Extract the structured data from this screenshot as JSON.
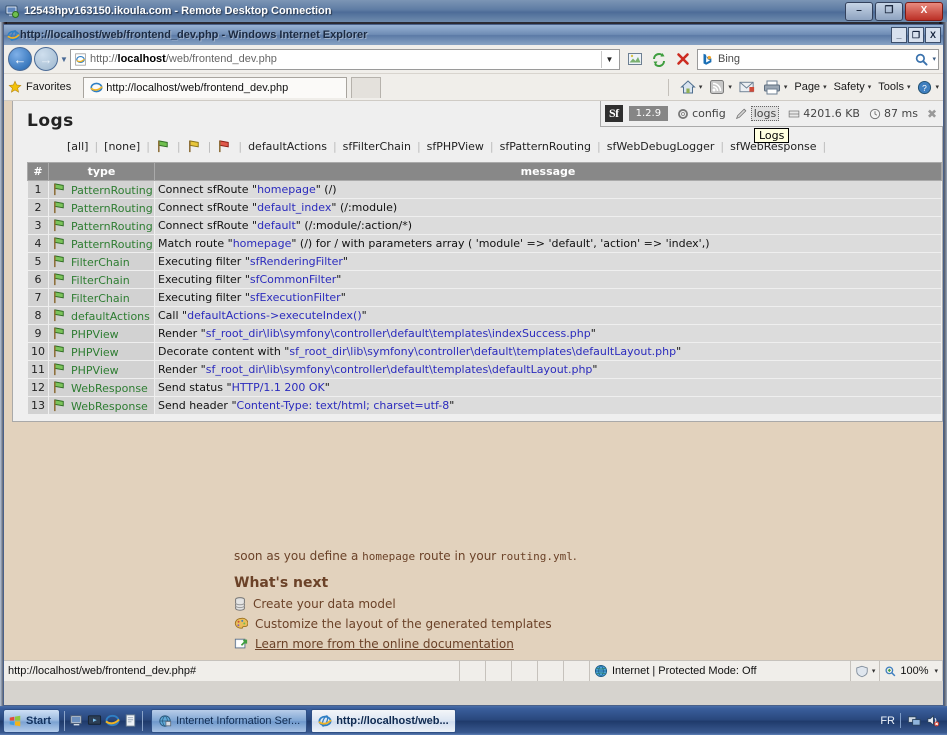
{
  "rdp": {
    "title": "12543hpv163150.ikoula.com - Remote Desktop Connection",
    "minimize": "–",
    "maximize": "❐",
    "close": "X"
  },
  "browser": {
    "title": "http://localhost/web/frontend_dev.php - Windows Internet Explorer",
    "title_min": "_",
    "title_restore": "❐",
    "title_close": "X",
    "address_bold": "localhost",
    "address_prefix": "http://",
    "address_suffix": "/web/frontend_dev.php",
    "address_full": "http://localhost/web/frontend_dev.php",
    "search_value": "Bing",
    "favorites_label": "Favorites",
    "tab_label": "http://localhost/web/frontend_dev.php",
    "commands": [
      {
        "label": "Page",
        "caret": "▾"
      },
      {
        "label": "Safety",
        "caret": "▾"
      },
      {
        "label": "Tools",
        "caret": "▾"
      }
    ]
  },
  "sf_toolbar": {
    "logo": "Sf",
    "version": "1.2.9",
    "config_label": "config",
    "logs_label": "logs",
    "memory_label": "4201.6 KB",
    "time_label": "87 ms",
    "close": "✖",
    "tooltip": "Logs"
  },
  "logs": {
    "title": "Logs",
    "filters": [
      "[all]",
      "[none]"
    ],
    "flag_filters": [
      "green-flag-icon",
      "yellow-flag-icon",
      "red-flag-icon"
    ],
    "type_filters": [
      "defaultActions",
      "sfFilterChain",
      "sfPHPView",
      "sfPatternRouting",
      "sfWebDebugLogger",
      "sfWebResponse"
    ],
    "columns": [
      "#",
      "type",
      "message"
    ],
    "rows": [
      {
        "num": "1",
        "type": "PatternRouting",
        "pre": "Connect sfRoute \"",
        "hl": "homepage",
        "post": "\" (/)"
      },
      {
        "num": "2",
        "type": "PatternRouting",
        "pre": "Connect sfRoute \"",
        "hl": "default_index",
        "post": "\" (/:module)"
      },
      {
        "num": "3",
        "type": "PatternRouting",
        "pre": "Connect sfRoute \"",
        "hl": "default",
        "post": "\" (/:module/:action/*)"
      },
      {
        "num": "4",
        "type": "PatternRouting",
        "pre": "Match route \"",
        "hl": "homepage",
        "post": "\" (/) for / with parameters array ( 'module' => 'default', 'action' => 'index',)"
      },
      {
        "num": "5",
        "type": "FilterChain",
        "pre": "Executing filter \"",
        "hl": "sfRenderingFilter",
        "post": "\""
      },
      {
        "num": "6",
        "type": "FilterChain",
        "pre": "Executing filter \"",
        "hl": "sfCommonFilter",
        "post": "\""
      },
      {
        "num": "7",
        "type": "FilterChain",
        "pre": "Executing filter \"",
        "hl": "sfExecutionFilter",
        "post": "\""
      },
      {
        "num": "8",
        "type": "defaultActions",
        "pre": "Call \"",
        "hl": "defaultActions->executeIndex()",
        "post": "\""
      },
      {
        "num": "9",
        "type": "PHPView",
        "pre": "Render \"",
        "hl": "sf_root_dir\\lib\\symfony\\controller\\default\\templates\\indexSuccess.php",
        "post": "\""
      },
      {
        "num": "10",
        "type": "PHPView",
        "pre": "Decorate content with \"",
        "hl": "sf_root_dir\\lib\\symfony\\controller\\default\\templates\\defaultLayout.php",
        "post": "\""
      },
      {
        "num": "11",
        "type": "PHPView",
        "pre": "Render \"",
        "hl": "sf_root_dir\\lib\\symfony\\controller\\default\\templates\\defaultLayout.php",
        "post": "\""
      },
      {
        "num": "12",
        "type": "WebResponse",
        "pre": "Send status \"",
        "hl": "HTTP/1.1 200 OK",
        "post": "\""
      },
      {
        "num": "13",
        "type": "WebResponse",
        "pre": "Send header \"",
        "hl": "Content-Type: text/html; charset=utf-8",
        "post": "\""
      }
    ]
  },
  "welcome": {
    "paragraph_pre": "soon as you define a ",
    "paragraph_code1": "homepage",
    "paragraph_mid": " route in your ",
    "paragraph_code2": "routing.yml",
    "paragraph_post": ".",
    "heading": "What's next",
    "items": [
      {
        "icon": "database-icon",
        "label": "Create your data model",
        "link": false
      },
      {
        "icon": "palette-icon",
        "label": "Customize the layout of the generated templates",
        "link": false
      },
      {
        "icon": "external-link-icon",
        "label": "Learn more from the online documentation",
        "link": true
      }
    ]
  },
  "status_bar": {
    "url": "http://localhost/web/frontend_dev.php#",
    "zone": "Internet | Protected Mode: Off",
    "zoom": "100%",
    "zoom_caret": "▾"
  },
  "taskbar": {
    "start": "Start",
    "tasks": [
      {
        "label": "Internet Information Ser...",
        "icon": "iis-icon",
        "active": false
      },
      {
        "label": "http://localhost/web...",
        "icon": "ie-icon",
        "active": true
      }
    ],
    "language": "FR"
  },
  "colors": {
    "page_background": "#e2d2bd",
    "panel_background": "#efefef",
    "table_header": "#888888",
    "row_background": "#dcdcdc",
    "highlight_text": "#2b2bbd",
    "type_text": "#2e7d32",
    "welcome_text": "#6b4228"
  }
}
